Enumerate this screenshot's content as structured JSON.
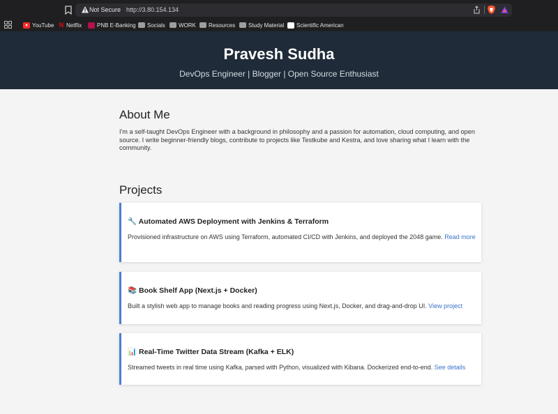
{
  "browser": {
    "security_label": "Not Secure",
    "url": "http://3.80.154.134",
    "bookmarks": [
      {
        "label": "YouTube",
        "icon": "youtube-icon"
      },
      {
        "label": "Netflix",
        "icon": "netflix-icon"
      },
      {
        "label": "PNB E-Banking",
        "icon": "pnb-icon"
      },
      {
        "label": "Socials",
        "icon": "folder-icon"
      },
      {
        "label": "WORK",
        "icon": "folder-icon"
      },
      {
        "label": "Resources",
        "icon": "folder-icon"
      },
      {
        "label": "Study Material",
        "icon": "folder-icon"
      },
      {
        "label": "Scientific American",
        "icon": "scientific-american-icon"
      }
    ]
  },
  "hero": {
    "name": "Pravesh Sudha",
    "tagline": "DevOps Engineer | Blogger | Open Source Enthusiast"
  },
  "about": {
    "title": "About Me",
    "body": "I'm a self-taught DevOps Engineer with a background in philosophy and a passion for automation, cloud computing, and open source. I write beginner-friendly blogs, contribute to projects like Testkube and Kestra, and love sharing what I learn with the community."
  },
  "projects": {
    "title": "Projects",
    "items": [
      {
        "emoji": "🔧",
        "title": "Automated AWS Deployment with Jenkins & Terraform",
        "description": "Provisioned infrastructure on AWS using Terraform, automated CI/CD with Jenkins, and deployed the 2048 game.",
        "link": "Read more"
      },
      {
        "emoji": "📚",
        "title": "Book Shelf App (Next.js + Docker)",
        "description": "Built a stylish web app to manage books and reading progress using Next.js, Docker, and drag-and-drop UI.",
        "link": "View project"
      },
      {
        "emoji": "📊",
        "title": "Real-Time Twitter Data Stream (Kafka + ELK)",
        "description": "Streamed tweets in real time using Kafka, parsed with Python, visualized with Kibana. Dockerized end-to-end.",
        "link": "See details"
      }
    ]
  },
  "colors": {
    "hero_bg": "#1f2b39",
    "card_accent": "#4a7fd1",
    "link": "#3b74c8"
  }
}
